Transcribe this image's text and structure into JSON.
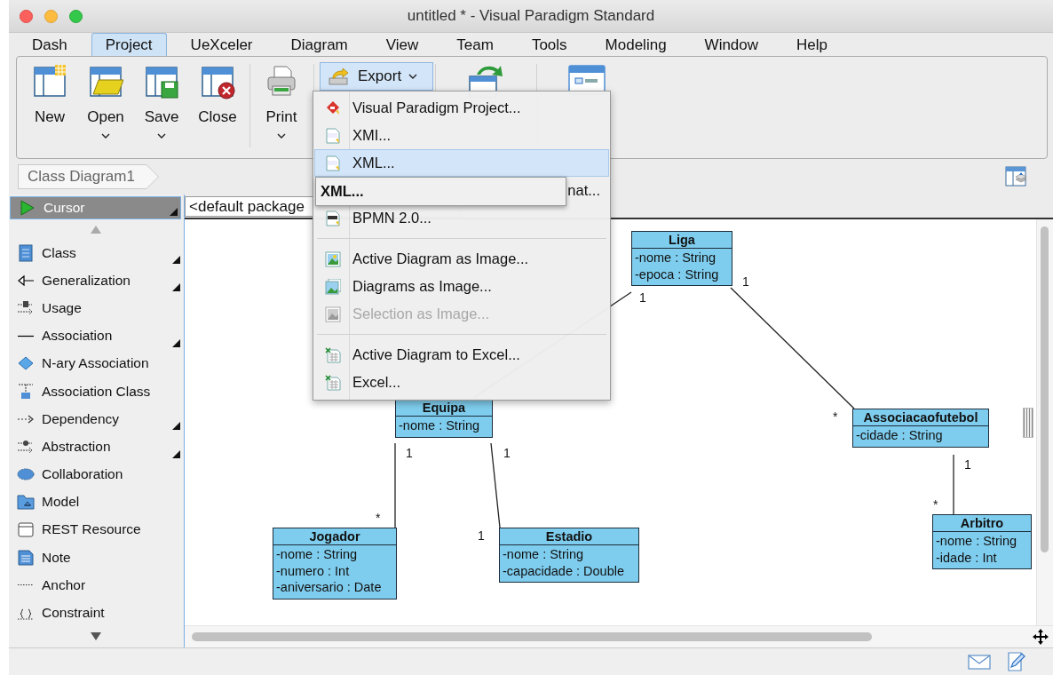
{
  "window": {
    "title": "untitled * - Visual Paradigm Standard"
  },
  "menu_tabs": [
    {
      "label": "Dash",
      "selected": false
    },
    {
      "label": "Project",
      "selected": true
    },
    {
      "label": "UeXceler",
      "selected": false
    },
    {
      "label": "Diagram",
      "selected": false
    },
    {
      "label": "View",
      "selected": false
    },
    {
      "label": "Team",
      "selected": false
    },
    {
      "label": "Tools",
      "selected": false
    },
    {
      "label": "Modeling",
      "selected": false
    },
    {
      "label": "Window",
      "selected": false
    },
    {
      "label": "Help",
      "selected": false
    }
  ],
  "ribbon": {
    "buttons": [
      {
        "label": "New",
        "has_dropdown": false
      },
      {
        "label": "Open",
        "has_dropdown": true
      },
      {
        "label": "Save",
        "has_dropdown": true
      },
      {
        "label": "Close",
        "has_dropdown": false
      },
      {
        "label": "Print",
        "has_dropdown": true
      }
    ],
    "export_button": {
      "label": "Export",
      "pressed": true
    }
  },
  "breadcrumb": {
    "label": "Class Diagram1"
  },
  "palette": {
    "items": [
      {
        "label": "Cursor",
        "selected": true,
        "has_submenu": true
      },
      {
        "label": "Class",
        "selected": false,
        "has_submenu": true
      },
      {
        "label": "Generalization",
        "selected": false,
        "has_submenu": true
      },
      {
        "label": "Usage",
        "selected": false,
        "has_submenu": false
      },
      {
        "label": "Association",
        "selected": false,
        "has_submenu": true
      },
      {
        "label": "N-ary Association",
        "selected": false,
        "has_submenu": false
      },
      {
        "label": "Association Class",
        "selected": false,
        "has_submenu": false
      },
      {
        "label": "Dependency",
        "selected": false,
        "has_submenu": true
      },
      {
        "label": "Abstraction",
        "selected": false,
        "has_submenu": true
      },
      {
        "label": "Collaboration",
        "selected": false,
        "has_submenu": false
      },
      {
        "label": "Model",
        "selected": false,
        "has_submenu": false
      },
      {
        "label": "REST Resource",
        "selected": false,
        "has_submenu": false
      },
      {
        "label": "Note",
        "selected": false,
        "has_submenu": false
      },
      {
        "label": "Anchor",
        "selected": false,
        "has_submenu": false
      },
      {
        "label": "Constraint",
        "selected": false,
        "has_submenu": false
      }
    ]
  },
  "package_field": {
    "value": "<default package"
  },
  "diagram": {
    "classes": [
      {
        "name": "Liga",
        "attributes": [
          "-nome : String",
          "-epoca : String"
        ]
      },
      {
        "name": "Equipa",
        "attributes": [
          "-nome : String"
        ]
      },
      {
        "name": "Associacaofutebol",
        "attributes": [
          "-cidade : String"
        ]
      },
      {
        "name": "Jogador",
        "attributes": [
          "-nome : String",
          "-numero : Int",
          "-aniversario : Date"
        ]
      },
      {
        "name": "Estadio",
        "attributes": [
          "-nome : String",
          "-capacidade : Double"
        ]
      },
      {
        "name": "Arbitro",
        "attributes": [
          "-nome : String",
          "-idade : Int"
        ]
      }
    ],
    "associations": [
      {
        "end_1": "1"
      },
      {
        "end_1": "1",
        "end_2": "*"
      },
      {
        "end_1": "1",
        "end_2": "*"
      },
      {
        "end_1": "1",
        "end_2": "1"
      },
      {
        "end_1": "1",
        "end_2": "*"
      }
    ]
  },
  "export_menu": {
    "items": [
      {
        "kind": "item",
        "label": "Visual Paradigm Project...",
        "selected": false,
        "disabled": false
      },
      {
        "kind": "item",
        "label": "XMI...",
        "selected": false,
        "disabled": false
      },
      {
        "kind": "item",
        "label": "XML...",
        "selected": true,
        "disabled": false
      },
      {
        "kind": "item",
        "label": "nat...",
        "selected": false,
        "disabled": false,
        "covered": true
      },
      {
        "kind": "item",
        "label": "BPMN 2.0...",
        "selected": false,
        "disabled": false
      },
      {
        "kind": "separator"
      },
      {
        "kind": "item",
        "label": "Active Diagram as Image...",
        "selected": false,
        "disabled": false
      },
      {
        "kind": "item",
        "label": "Diagrams as Image...",
        "selected": false,
        "disabled": false
      },
      {
        "kind": "item",
        "label": "Selection as Image...",
        "selected": false,
        "disabled": true
      },
      {
        "kind": "separator"
      },
      {
        "kind": "item",
        "label": "Active Diagram to Excel...",
        "selected": false,
        "disabled": false
      },
      {
        "kind": "item",
        "label": "Excel...",
        "selected": false,
        "disabled": false
      }
    ]
  },
  "tooltip": {
    "text": "XML..."
  }
}
